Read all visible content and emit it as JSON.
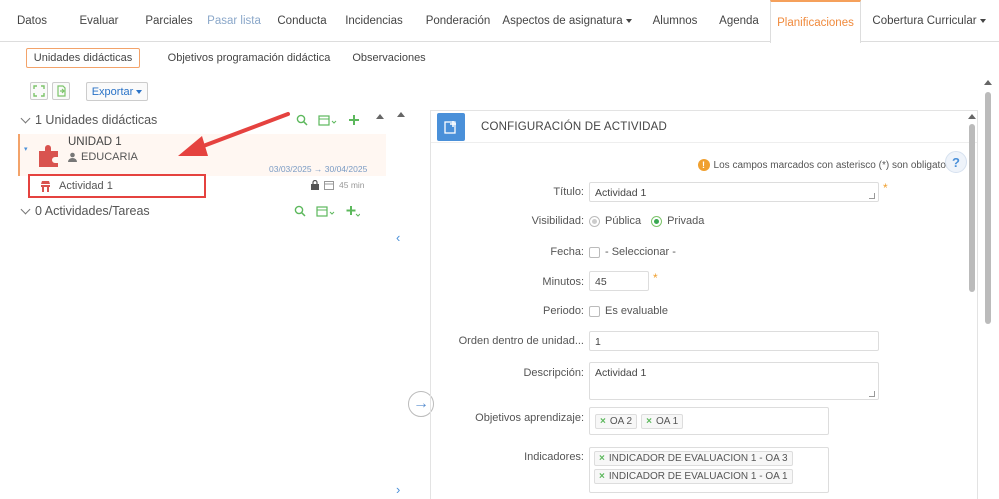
{
  "top_tabs": [
    {
      "label": "Datos"
    },
    {
      "label": "Evaluar"
    },
    {
      "label": "Parciales"
    },
    {
      "label": "Pasar lista"
    },
    {
      "label": "Conducta"
    },
    {
      "label": "Incidencias"
    },
    {
      "label": "Ponderación"
    },
    {
      "label": "Aspectos de asignatura"
    },
    {
      "label": "Alumnos"
    },
    {
      "label": "Agenda"
    },
    {
      "label": "Planificaciones"
    },
    {
      "label": "Cobertura Curricular"
    }
  ],
  "sub_tabs": [
    {
      "label": "Unidades didácticas"
    },
    {
      "label": "Objetivos programación didáctica"
    },
    {
      "label": "Observaciones"
    }
  ],
  "toolbar": {
    "export_label": "Exportar"
  },
  "left": {
    "units_header": "1 Unidades didácticas",
    "unit": {
      "title": "UNIDAD 1",
      "owner": "EDUCARIA",
      "date_range": "03/03/2025 → 30/04/2025"
    },
    "activity": {
      "label": "Actividad 1",
      "duration": "45 min"
    },
    "tasks_header": "0 Actividades/Tareas"
  },
  "form": {
    "title": "CONFIGURACIÓN DE ACTIVIDAD",
    "required_note": "Los campos marcados con asterisco (*) son obligatorio",
    "help": "?",
    "fields": {
      "titulo": {
        "label": "Título:",
        "value": "Actividad 1"
      },
      "visibilidad": {
        "label": "Visibilidad:",
        "options": [
          "Pública",
          "Privada"
        ],
        "selected": "Privada"
      },
      "fecha": {
        "label": "Fecha:",
        "value": "- Seleccionar -"
      },
      "minutos": {
        "label": "Minutos:",
        "value": "45"
      },
      "periodo": {
        "label": "Periodo:",
        "value": "Es evaluable"
      },
      "orden": {
        "label": "Orden dentro de unidad...",
        "value": "1"
      },
      "descripcion": {
        "label": "Descripción:",
        "value": "Actividad 1"
      },
      "objetivos": {
        "label": "Objetivos aprendizaje:",
        "tags": [
          "OA 2",
          "OA 1"
        ]
      },
      "indicadores": {
        "label": "Indicadores:",
        "tags": [
          "INDICADOR DE EVALUACION 1 - OA 3",
          "INDICADOR DE EVALUACION 1 - OA 1"
        ]
      }
    }
  },
  "colors": {
    "accent": "#f08a3c",
    "blue": "#4a90d9",
    "annotation": "#e5423f",
    "green": "#3aa852"
  }
}
